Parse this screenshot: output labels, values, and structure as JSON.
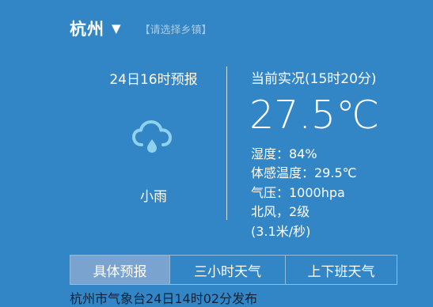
{
  "location": {
    "city": "杭州",
    "dropdown_icon": "caret-down-icon",
    "town_selector": "【请选择乡镇】"
  },
  "forecast": {
    "title": "24日16时预报",
    "icon": "cloud-rain-icon",
    "condition": "小雨"
  },
  "current": {
    "title": "当前实况(15时20分)",
    "temperature": "27.5℃",
    "humidity": "湿度：84%",
    "feels_like": "体感温度：29.5℃",
    "pressure": "气压：1000hpa",
    "wind": "北风，2级",
    "wind_speed": "(3.1米/秒)"
  },
  "tabs": [
    {
      "label": "具体预报",
      "active": true
    },
    {
      "label": "三小时天气",
      "active": false
    },
    {
      "label": "上下班天气",
      "active": false
    }
  ],
  "footer": {
    "publish_note": "杭州市气象台24日14时02分发布"
  },
  "colors": {
    "background": "#3386c6",
    "active_tab": "#7aa3cf",
    "town_selector_text": "#a6cbe7",
    "footer_text": "#0d2236"
  }
}
